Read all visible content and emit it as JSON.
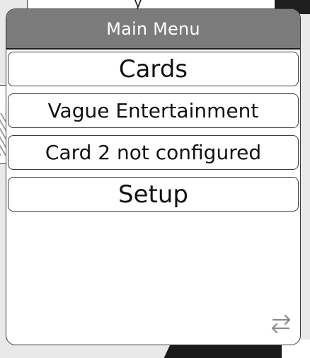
{
  "dialog": {
    "title": "Main Menu"
  },
  "menu": {
    "items": [
      {
        "label": "Cards"
      },
      {
        "label": "Vague Entertainment"
      },
      {
        "label": "Card 2 not configured"
      },
      {
        "label": "Setup"
      }
    ]
  },
  "icons": {
    "corner": "swap-arrows-icon"
  },
  "colors": {
    "header_bg": "#7b7b7b",
    "header_text": "#ffffff",
    "item_border": "#3d3d3d"
  }
}
